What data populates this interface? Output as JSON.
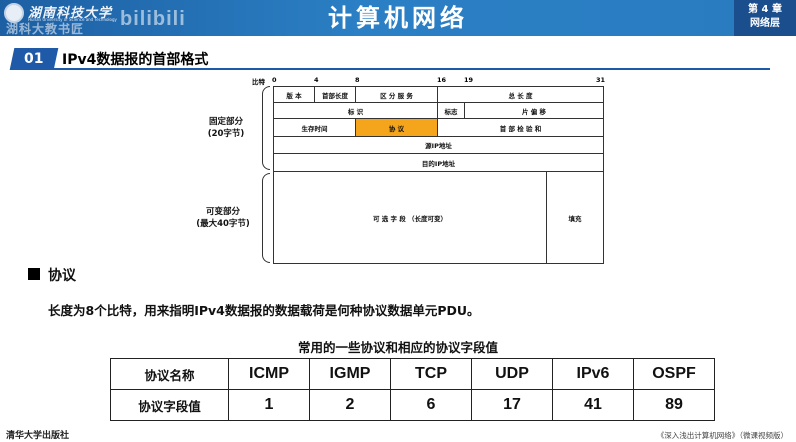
{
  "header": {
    "university_name": "湖南科技大学",
    "university_name_en": "Hunan University of Science and Technology",
    "watermark": "湖科大教书匠",
    "bilibili": "bilibili",
    "course_title": "计算机网络",
    "chapter": "第 4 章",
    "chapter_name": "网络层"
  },
  "section": {
    "number": "01",
    "title": "IPv4数据报的首部格式"
  },
  "diagram": {
    "bits_label": "比特",
    "bit_marks": [
      "0",
      "4",
      "8",
      "16",
      "19",
      "31"
    ],
    "fixed_part_label": "固定部分",
    "fixed_part_size": "(20字节)",
    "variable_part_label": "可变部分",
    "variable_part_size": "(最大40字节)",
    "fields": {
      "version": "版  本",
      "header_length": "首部长度",
      "diff_services": "区 分 服 务",
      "total_length": "总 长 度",
      "identification": "标       识",
      "flags": "标志",
      "fragment_offset": "片 偏 移",
      "ttl": "生存时间",
      "protocol": "协    议",
      "header_checksum": "首 部 检 验 和",
      "source_ip": "源IP地址",
      "dest_ip": "目的IP地址",
      "options": "可 选 字 段 （长度可变）",
      "padding": "填充"
    },
    "highlight_color": "#f4a51c"
  },
  "protocol_section": {
    "heading": "协议",
    "description": "长度为8个比特，用来指明IPv4数据报的数据载荷是何种协议数据单元PDU。"
  },
  "table": {
    "caption": "常用的一些协议和相应的协议字段值",
    "row_headers": [
      "协议名称",
      "协议字段值"
    ],
    "protocols": [
      "ICMP",
      "IGMP",
      "TCP",
      "UDP",
      "IPv6",
      "OSPF"
    ],
    "values": [
      "1",
      "2",
      "6",
      "17",
      "41",
      "89"
    ]
  },
  "footer": {
    "publisher": "清华大学出版社",
    "book_title": "《深入浅出计算机网络》（微课视频版）"
  }
}
